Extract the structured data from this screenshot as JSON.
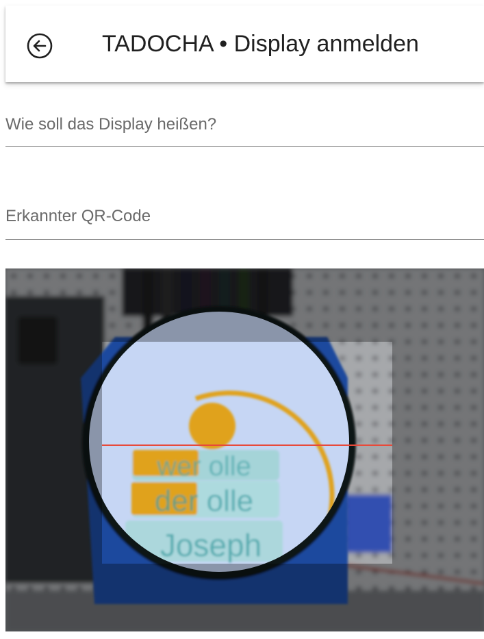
{
  "app_bar": {
    "title": "TADOCHA • Display anmelden",
    "back_icon": "arrow-left-circle-icon"
  },
  "form": {
    "display_name": {
      "placeholder": "Wie soll das Display heißen?",
      "value": ""
    },
    "qr_code": {
      "placeholder": "Erkannter QR-Code",
      "value": ""
    }
  },
  "camera_preview": {
    "display_texts": [
      "wer olle",
      "der olle",
      "Joseph"
    ],
    "colors": {
      "scan_line": "#e84a3a",
      "screen": "#c6d6f4",
      "board": "#1f4a9e",
      "accent": "#e0a21a"
    }
  }
}
